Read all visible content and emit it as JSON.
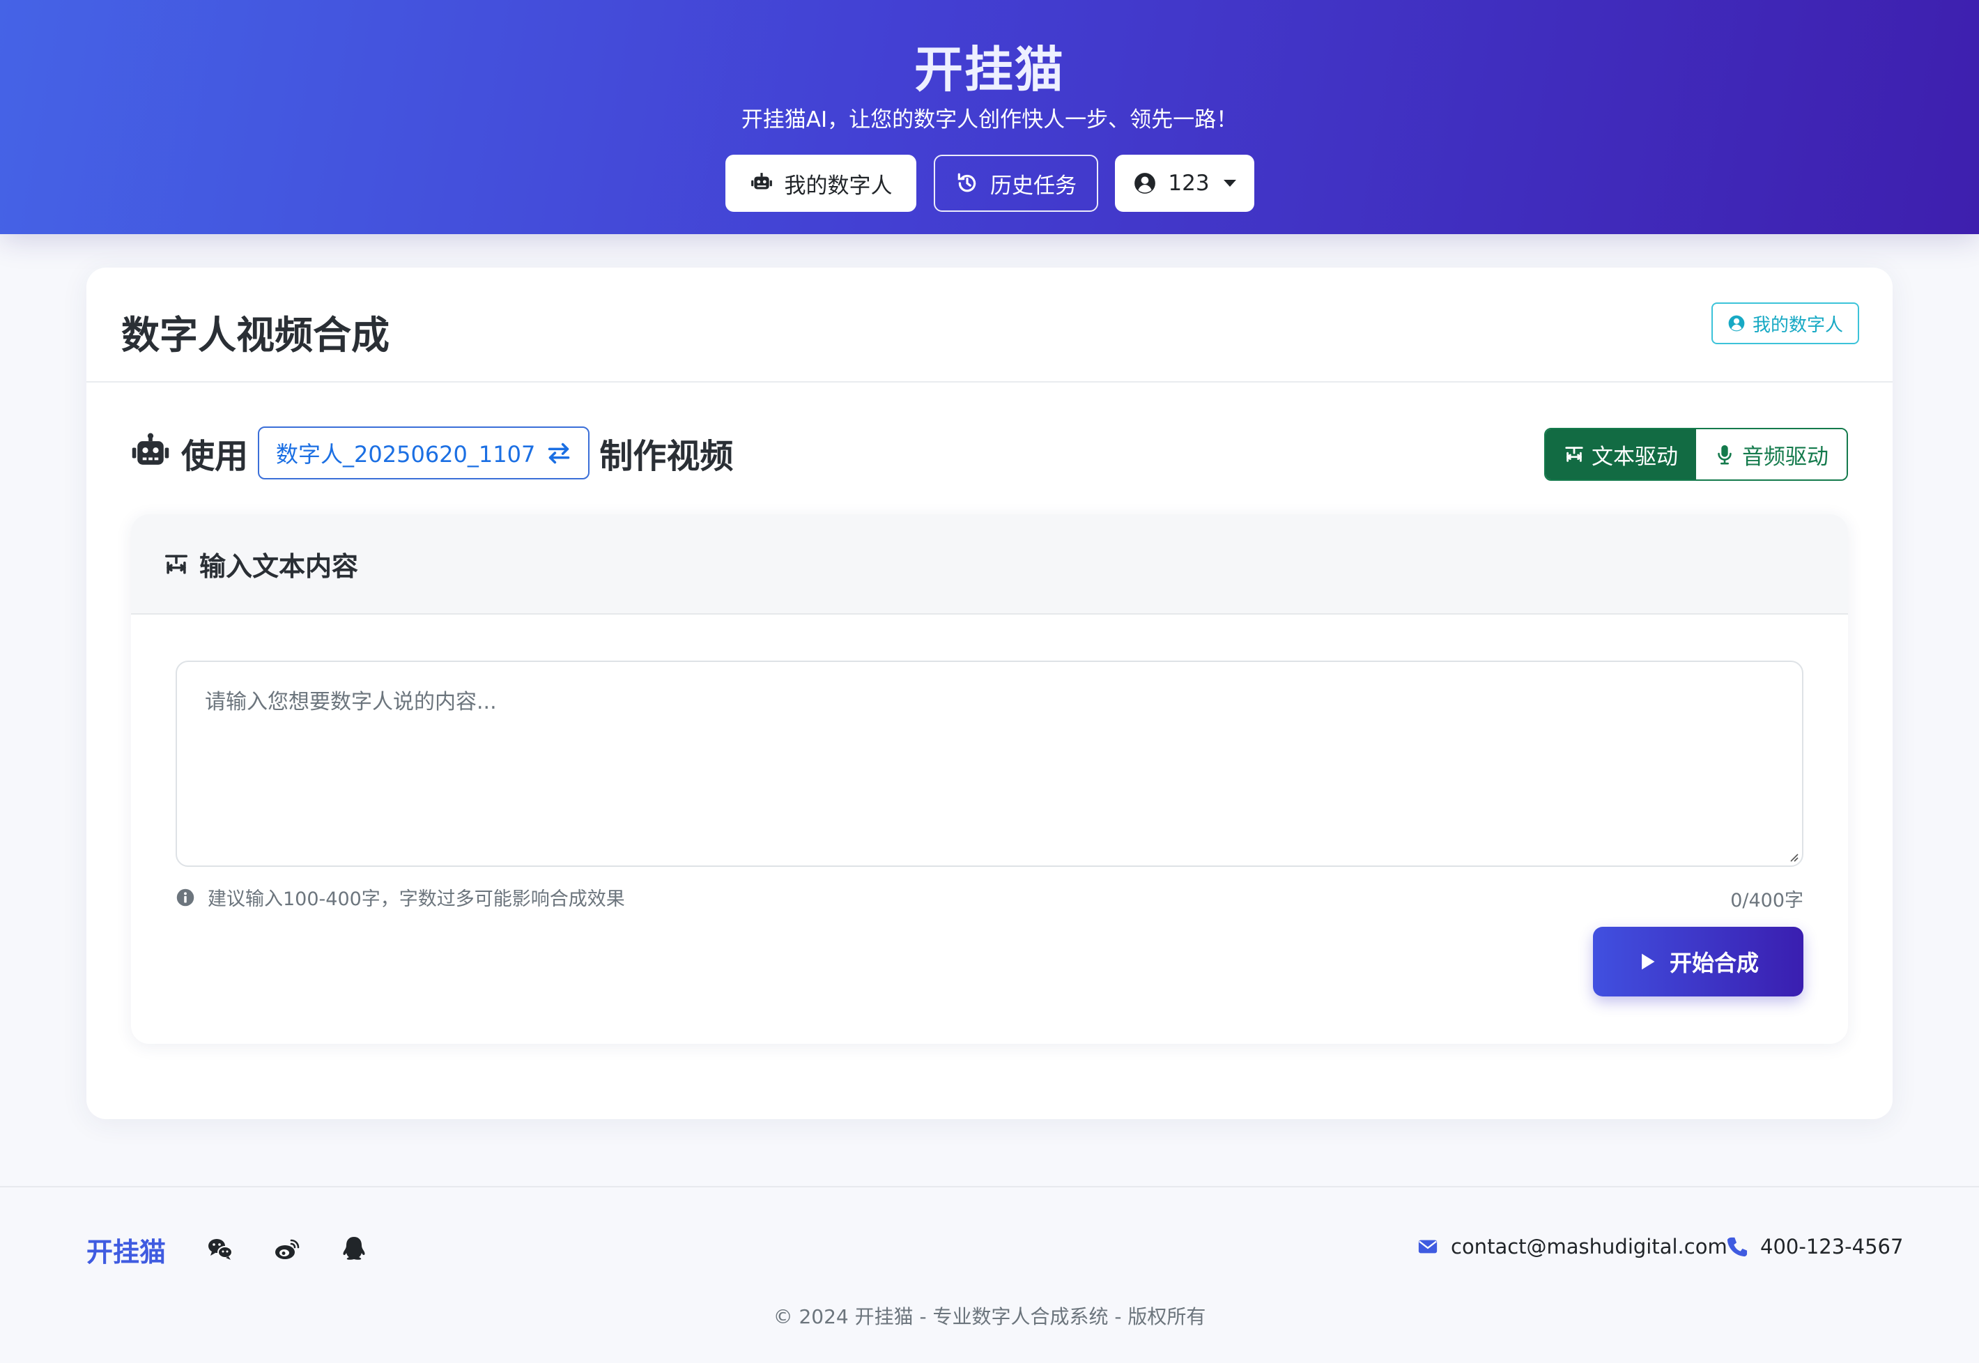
{
  "header": {
    "brand": "开挂猫",
    "tagline": "开挂猫AI，让您的数字人创作快人一步、领先一路！",
    "btn_my_avatar": "我的数字人",
    "btn_history": "历史任务",
    "btn_user": "123",
    "colors": {
      "gradient_start": "#4563e6",
      "gradient_end": "#3e1fae"
    }
  },
  "card": {
    "title": "数字人视频合成",
    "my_avatar_label": "我的数字人",
    "use_prefix": "使用",
    "selected_avatar": "数字人_20250620_1107",
    "use_suffix": "制作视频",
    "mode_text": "文本驱动",
    "mode_audio": "音频驱动",
    "accent_green": "#126b43"
  },
  "input_panel": {
    "title": "输入文本内容",
    "placeholder": "请输入您想要数字人说的内容...",
    "hint": "建议输入100-400字，字数过多可能影响合成效果",
    "counter": "0/400字",
    "start_button": "开始合成"
  },
  "footer": {
    "brand": "开挂猫",
    "social_icons": [
      "wechat-icon",
      "weibo-icon",
      "qq-icon"
    ],
    "email": "contact@mashudigital.com",
    "phone": "400-123-4567",
    "copyright": "© 2024 开挂猫 - 专业数字人合成系统 - 版权所有"
  }
}
